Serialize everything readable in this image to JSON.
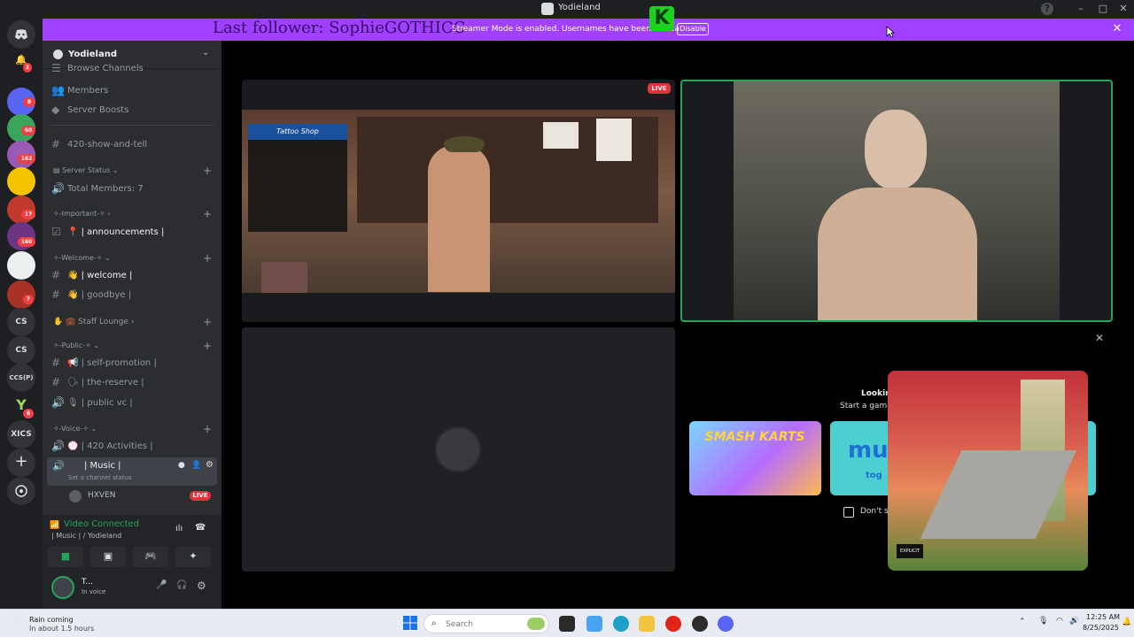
{
  "window": {
    "title": "Yodieland"
  },
  "banner": {
    "last_follower": "Last follower: SophieGOTHICC",
    "message": "Streamer Mode is enabled. Usernames have been trunca",
    "disable_label": "Disable",
    "close_glyph": "✕",
    "overlay_logo": "K",
    "color": "#a041ff"
  },
  "rail": {
    "items": [
      {
        "label": "",
        "badge": "2"
      },
      {
        "label": "",
        "badge": "8"
      },
      {
        "label": "",
        "badge": "60"
      },
      {
        "label": "",
        "badge": "162"
      },
      {
        "label": "",
        "badge": ""
      },
      {
        "label": "",
        "badge": "17"
      },
      {
        "label": "",
        "badge": "160"
      },
      {
        "label": "",
        "badge": ""
      },
      {
        "label": "",
        "badge": "7"
      },
      {
        "label": "CS",
        "badge": ""
      },
      {
        "label": "CS",
        "badge": ""
      },
      {
        "label": "CCS(P)",
        "badge": ""
      },
      {
        "label": "",
        "badge": "6"
      },
      {
        "label": "XICS",
        "badge": ""
      }
    ]
  },
  "sidebar": {
    "server_name": "Yodieland",
    "channels": {
      "browse": "Browse Channels",
      "members": "Members",
      "boosts": "Server Boosts",
      "show_and_tell": "420-show-and-tell",
      "server_status_cat": "Server Status",
      "total_members": "Total Members: 7",
      "important_cat": "✧-Important-✧",
      "announcements": "📍 | announcements |",
      "welcome_cat": "✧-Welcome-✧",
      "welcome": "👋 | welcome |",
      "goodbye": "👋 | goodbye |",
      "staff_cat": "✋ 💼 Staff Lounge",
      "public_cat": "✧-Public-✧",
      "self_promotion": "📢 | self-promotion |",
      "the_reserve": "🗣 | the-reserve |",
      "public_vc": "🎙 | public vc |",
      "voice_cat": "✧-Voice-✧",
      "activities": "💮 | 420 Activities |",
      "music": "| Music |",
      "set_status": "Set a channel status",
      "member_name": "HXVEN",
      "live_badge": "LIVE"
    },
    "voice_panel": {
      "status": "Video Connected",
      "location": "| Music | / Yodieland"
    },
    "user": {
      "name": "T...",
      "status": "In voice"
    }
  },
  "stage": {
    "live_badge": "LIVE",
    "game_overlay_title": "Tattoo Shop",
    "activity_title": "Looking for s",
    "activity_sub": "Start a game or v",
    "game_card_1": "SMASH KARTS",
    "game_card_2": "mu",
    "game_card_2_sub": "tog",
    "dont_show": "Don't sh",
    "close_glyph": "✕"
  },
  "taskbar": {
    "weather_title": "Rain coming",
    "weather_sub": "In about 1.5 hours",
    "search_placeholder": "Search",
    "time": "12:25 AM",
    "date": "8/25/2025"
  }
}
